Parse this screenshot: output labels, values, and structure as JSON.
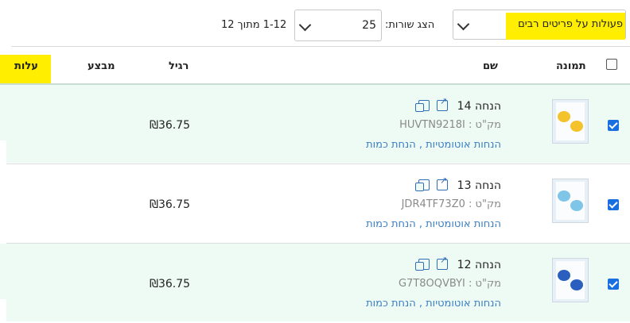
{
  "toolbar": {
    "bulk_actions": "פעולות על פריטים רבים",
    "rows_label": "הצג שורות:",
    "rows_value": "25",
    "paging": "1-12 מתוך 12"
  },
  "headers": {
    "image": "תמונה",
    "name": "שם",
    "regular": "רגיל",
    "sale": "מבצע",
    "cost": "עלות"
  },
  "colors": {
    "highlight": "#ffee00",
    "row_selected": "#eefbf4",
    "link": "#3a7fc4",
    "checkbox": "#1a6fe0"
  },
  "rows": [
    {
      "name": "הנחה 14",
      "sku": "מק\"ט : HUVTN9218I",
      "tags": "הנחות אוטומטיות , הנחת כמות",
      "price": "₪36.75",
      "thumb_color": "#f4c22b",
      "selected": true
    },
    {
      "name": "הנחה 13",
      "sku": "מק\"ט : JDR4TF73Z0",
      "tags": "הנחות אוטומטיות , הנחת כמות",
      "price": "₪36.75",
      "thumb_color": "#7fc5e8",
      "selected": true
    },
    {
      "name": "הנחה 12",
      "sku": "מק\"ט : G7T8OQVBYI",
      "tags": "הנחות אוטומטיות , הנחת כמות",
      "price": "₪36.75",
      "thumb_color": "#2a5fc0",
      "selected": true
    }
  ]
}
